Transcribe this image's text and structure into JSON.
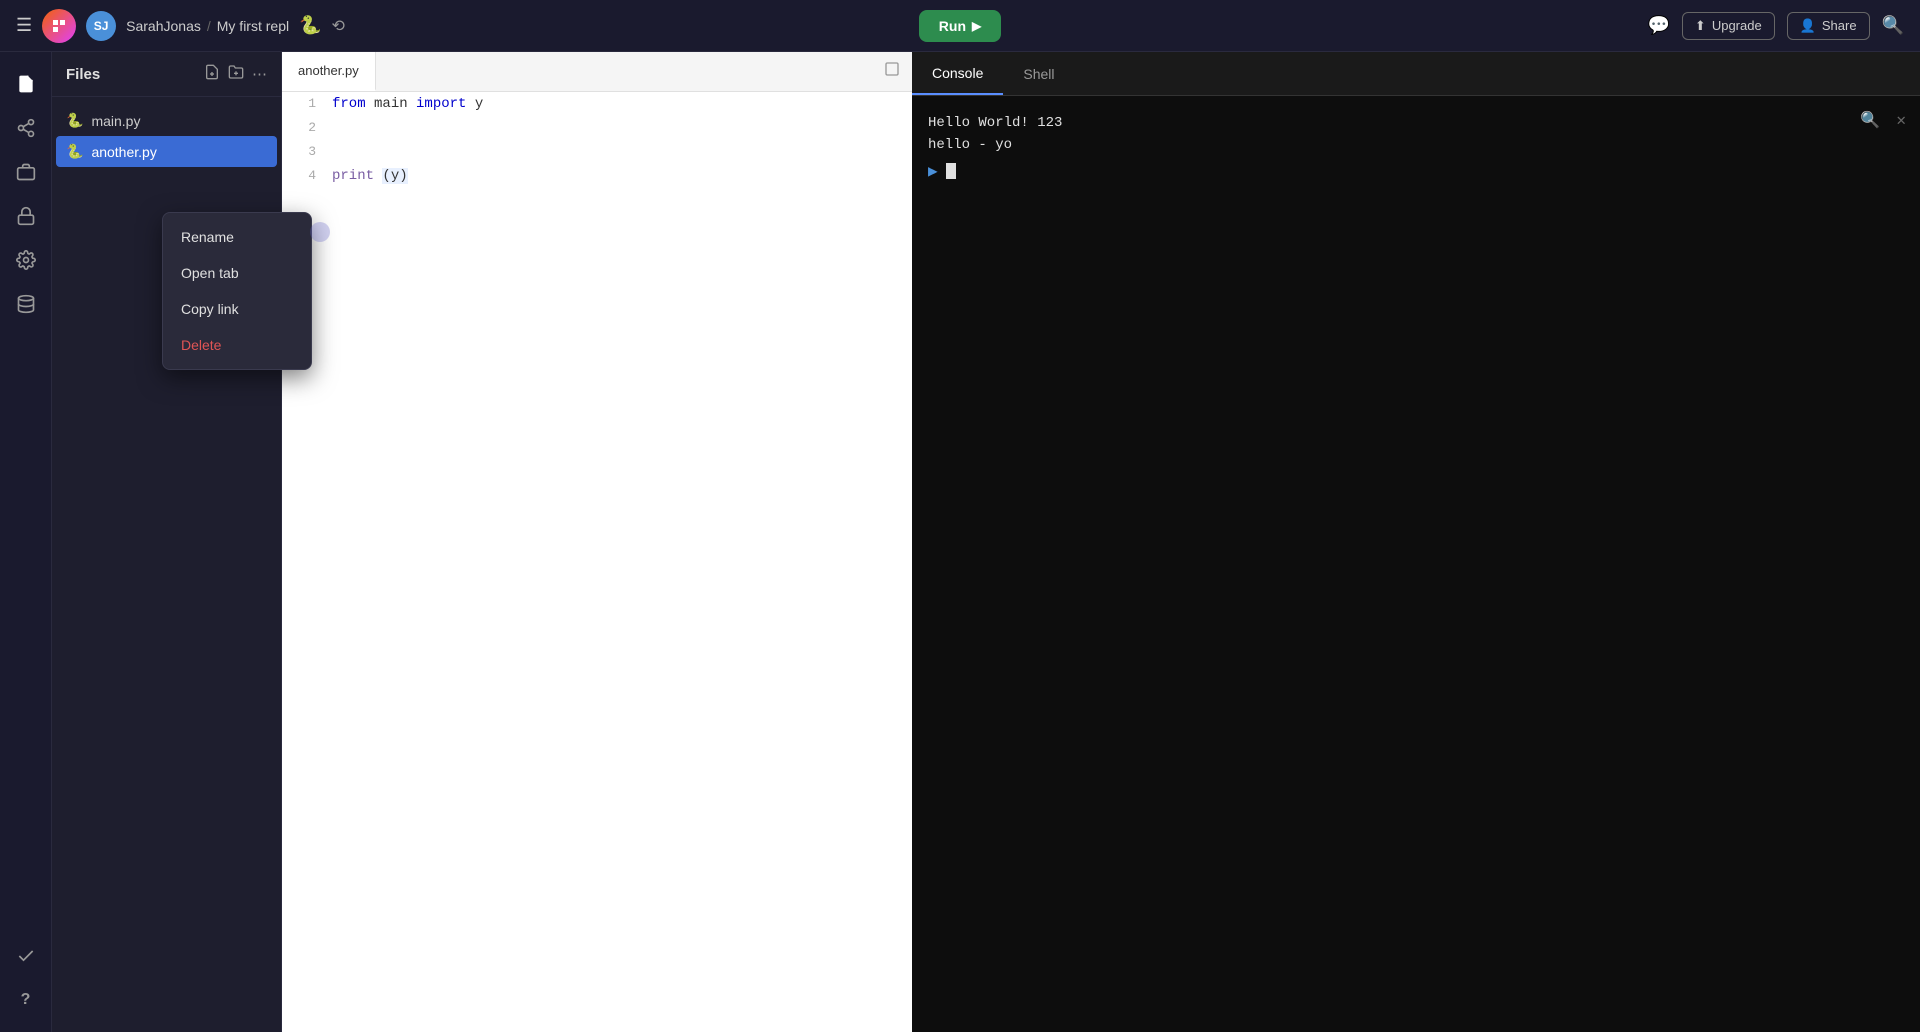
{
  "topbar": {
    "user": "SarahJonas",
    "separator": "/",
    "project": "My first repl",
    "run_label": "Run",
    "upgrade_label": "Upgrade",
    "share_label": "Share"
  },
  "sidebar": {
    "icons": [
      {
        "name": "files-icon",
        "symbol": "📄",
        "active": true
      },
      {
        "name": "share-sidebar-icon",
        "symbol": "⬆",
        "active": false
      },
      {
        "name": "packages-icon",
        "symbol": "📦",
        "active": false
      },
      {
        "name": "secrets-icon",
        "symbol": "🔒",
        "active": false
      },
      {
        "name": "settings-icon",
        "symbol": "⚙",
        "active": false
      },
      {
        "name": "database-icon",
        "symbol": "🗄",
        "active": false
      },
      {
        "name": "checkmark-icon",
        "symbol": "✓",
        "active": false
      },
      {
        "name": "help-icon",
        "symbol": "?",
        "bottom": true
      }
    ]
  },
  "file_panel": {
    "title": "Files",
    "files": [
      {
        "name": "main.py",
        "selected": false
      },
      {
        "name": "another.py",
        "selected": true
      }
    ],
    "context_menu": {
      "items": [
        {
          "label": "Rename",
          "danger": false
        },
        {
          "label": "Open tab",
          "danger": false
        },
        {
          "label": "Copy link",
          "danger": false
        },
        {
          "label": "Delete",
          "danger": true
        }
      ]
    }
  },
  "editor": {
    "tab_name": "another.py",
    "lines": [
      {
        "number": "1",
        "content": "from main import y"
      },
      {
        "number": "2",
        "content": ""
      },
      {
        "number": "3",
        "content": ""
      },
      {
        "number": "4",
        "content": "print (y)"
      }
    ]
  },
  "console": {
    "tabs": [
      {
        "label": "Console",
        "active": true
      },
      {
        "label": "Shell",
        "active": false
      }
    ],
    "output": [
      "Hello World! 123",
      "hello - yo"
    ],
    "prompt_symbol": "▶"
  }
}
